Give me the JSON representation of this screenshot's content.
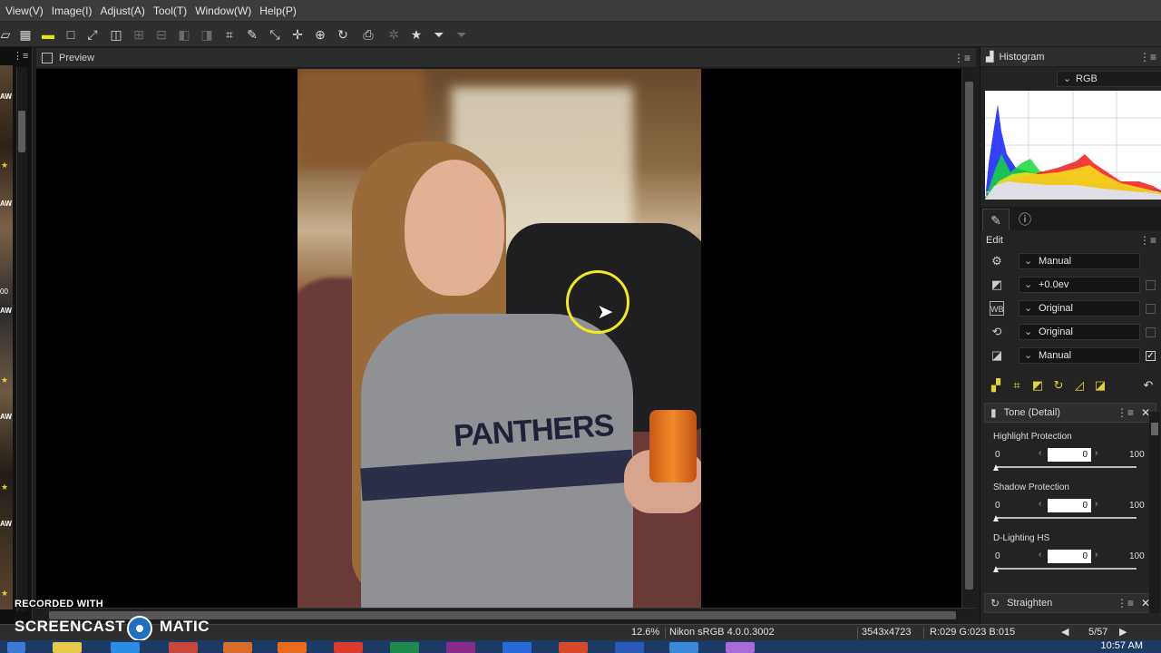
{
  "menubar": {
    "items": [
      "View(V)",
      "Image(I)",
      "Adjust(A)",
      "Tool(T)",
      "Window(W)",
      "Help(P)"
    ]
  },
  "toolbar": {
    "icons": [
      "folder-icon",
      "grid-icon",
      "filmstrip-icon",
      "single-view-icon",
      "fullscreen-icon",
      "compare-2-icon",
      "compare-4-icon",
      "compare-dim-icon",
      "compare-dim2-icon",
      "compare-dim3-icon",
      "crop-icon",
      "straighten-icon",
      "move-icon",
      "pan-icon",
      "magnify-icon",
      "rotate-icon",
      "export-icon",
      "gear-icon",
      "star-icon",
      "filter-icon",
      "filter-dim-icon"
    ]
  },
  "filmstrip": {
    "labels": [
      "AW",
      "AW",
      "AW",
      "AW",
      "AW",
      "AW"
    ],
    "values": [
      "00"
    ]
  },
  "preview": {
    "title": "Preview",
    "shirt_text": "PANTHERS"
  },
  "histogram": {
    "title": "Histogram",
    "channel": "RGB",
    "min": "0",
    "max": "255"
  },
  "edit": {
    "title": "Edit",
    "rows": [
      {
        "icon": "gear-icon",
        "value": "Manual"
      },
      {
        "icon": "exposure-icon",
        "value": "+0.0ev"
      },
      {
        "icon": "wb-icon",
        "value": "Original"
      },
      {
        "icon": "picture-control-icon",
        "value": "Original"
      },
      {
        "icon": "tone-icon",
        "value": "Manual"
      }
    ]
  },
  "tone_detail": {
    "title": "Tone (Detail)",
    "sliders": [
      {
        "name": "Highlight Protection",
        "min": "0",
        "max": "100",
        "value": "0"
      },
      {
        "name": "Shadow Protection",
        "min": "0",
        "max": "100",
        "value": "0"
      },
      {
        "name": "D-Lighting HS",
        "min": "0",
        "max": "100",
        "value": "0"
      }
    ]
  },
  "straighten": {
    "title": "Straighten"
  },
  "statusbar": {
    "zoom": "12.6%",
    "profile": "Nikon sRGB 4.0.0.3002",
    "dimensions": "3543x4723",
    "color_readout": "R:029 G:023 B:015",
    "position": "5/57"
  },
  "watermark": {
    "recorded": "RECORDED WITH",
    "brand_left": "SCREENCAST",
    "brand_right": "MATIC"
  },
  "taskbar": {
    "clock": "10:57 AM"
  },
  "colors": {
    "accent": "#e6e60a",
    "panel": "#232323",
    "cursor_ring": "#f2ea1c"
  }
}
